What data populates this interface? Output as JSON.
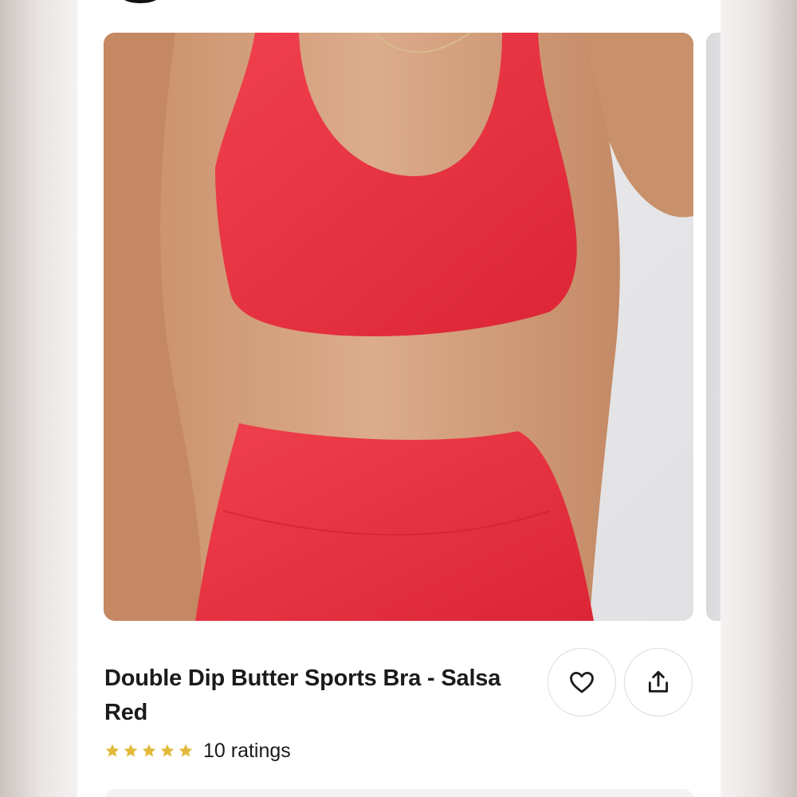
{
  "product": {
    "title": "Double Dip Butter Sports Bra - Salsa Red",
    "rating": 5,
    "max_rating": 5,
    "ratings_count_text": "10 ratings",
    "color_name": "Salsa Red",
    "image_color": "#e8303f"
  },
  "actions": {
    "favorite_icon": "heart-icon",
    "share_icon": "share-icon"
  },
  "colors": {
    "star": "#e2b93b",
    "text": "#1b1b1b",
    "button_border": "#dcdcdc"
  }
}
